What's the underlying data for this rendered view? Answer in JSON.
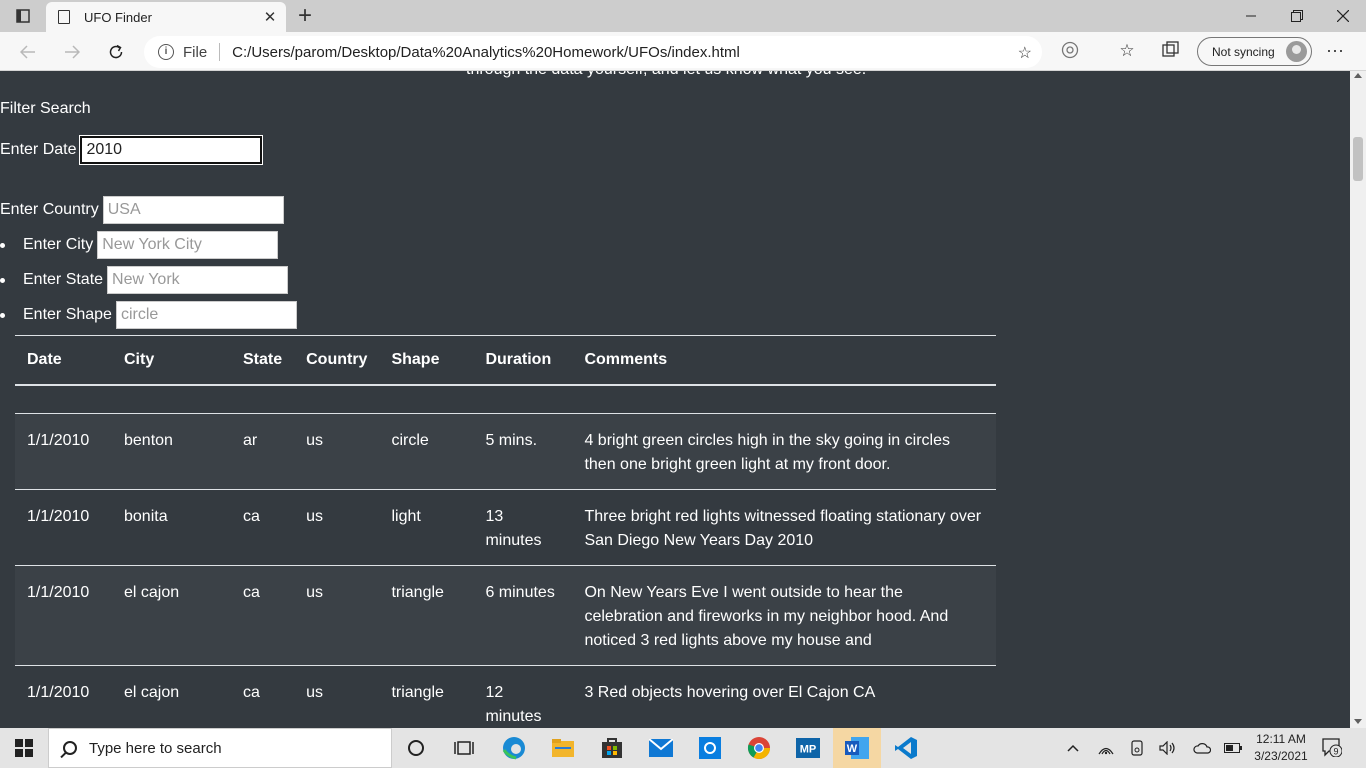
{
  "browser": {
    "tab_title": "UFO Finder",
    "tab_close": "✕",
    "new_tab": "+",
    "address_scheme": "File",
    "address_url": "C:/Users/parom/Desktop/Data%20Analytics%20Homework/UFOs/index.html",
    "sync_label": "Not syncing",
    "more": "···"
  },
  "page": {
    "cut_text": "through the data yourself, and let us know what you see.",
    "filter_title": "Filter Search",
    "filters": {
      "date": {
        "label": "Enter Date",
        "value": "2010",
        "placeholder": ""
      },
      "country": {
        "label": "Enter Country",
        "placeholder": "USA"
      },
      "city": {
        "label": "Enter City",
        "placeholder": "New York City"
      },
      "state": {
        "label": "Enter State",
        "placeholder": "New York"
      },
      "shape": {
        "label": "Enter Shape",
        "placeholder": "circle"
      }
    },
    "table": {
      "headers": [
        "Date",
        "City",
        "State",
        "Country",
        "Shape",
        "Duration",
        "Comments"
      ],
      "rows": [
        [
          "1/1/2010",
          "benton",
          "ar",
          "us",
          "circle",
          "5 mins.",
          "4 bright green circles high in the sky going in circles then one bright green light at my front door."
        ],
        [
          "1/1/2010",
          "bonita",
          "ca",
          "us",
          "light",
          "13 minutes",
          "Three bright red lights witnessed floating stationary over San Diego New Years Day 2010"
        ],
        [
          "1/1/2010",
          "el cajon",
          "ca",
          "us",
          "triangle",
          "6 minutes",
          "On New Years Eve I went outside to hear the celebration and fireworks in my neighbor hood. And noticed 3 red lights above my house and"
        ],
        [
          "1/1/2010",
          "el cajon",
          "ca",
          "us",
          "triangle",
          "12 minutes",
          "3 Red objects hovering over El Cajon CA"
        ]
      ]
    }
  },
  "taskbar": {
    "search_placeholder": "Type here to search",
    "time": "12:11 AM",
    "date": "3/23/2021",
    "notification_count": "9"
  },
  "colors": {
    "page_bg": "#343a40",
    "row_stripe": "#3b4147",
    "table_border": "#dee2e6"
  }
}
